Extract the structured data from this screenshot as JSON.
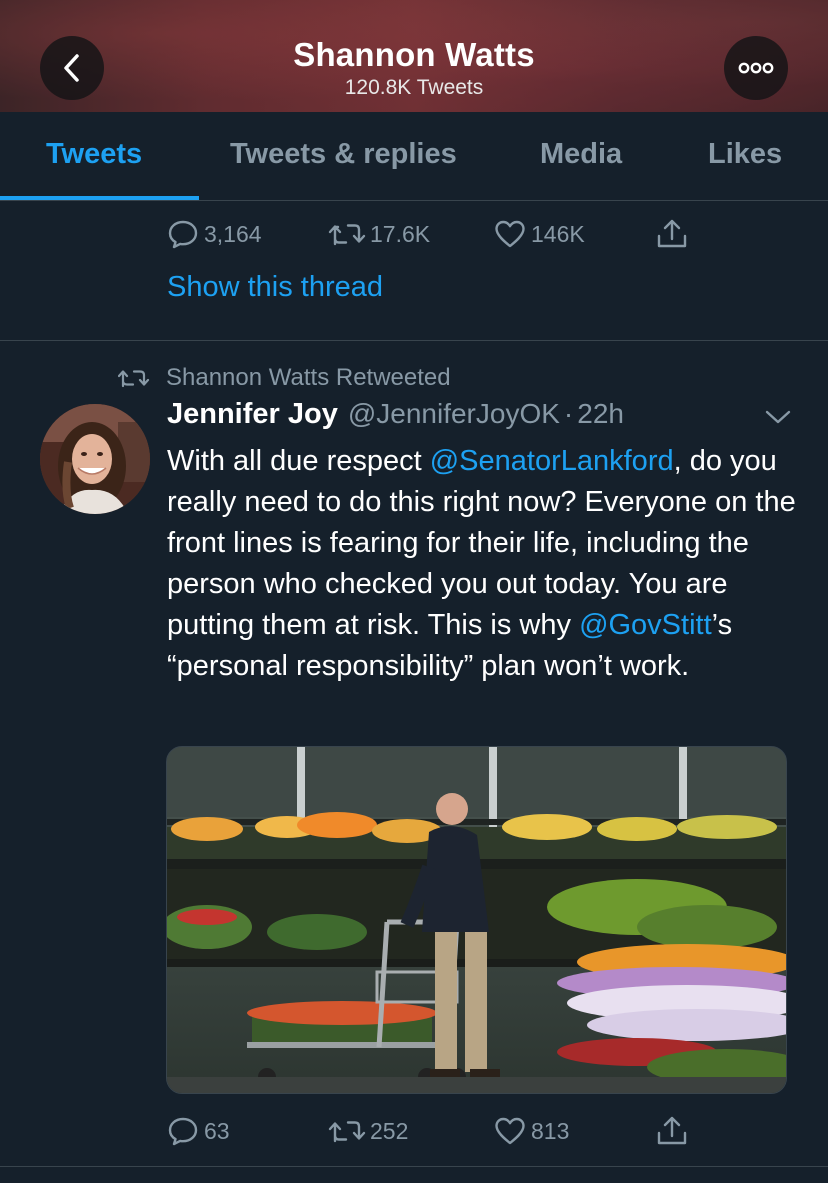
{
  "header": {
    "title": "Shannon Watts",
    "subtitle": "120.8K Tweets"
  },
  "tabs": [
    {
      "label": "Tweets",
      "active": true
    },
    {
      "label": "Tweets & replies",
      "active": false
    },
    {
      "label": "Media",
      "active": false
    },
    {
      "label": "Likes",
      "active": false
    }
  ],
  "prev_tweet": {
    "replies": "3,164",
    "retweets": "17.6K",
    "likes": "146K",
    "show_thread": "Show this thread"
  },
  "tweet": {
    "retweet_context": "Shannon Watts Retweeted",
    "author_name": "Jennifer Joy",
    "author_handle": "@JenniferJoyOK",
    "separator": "·",
    "time": "22h",
    "text_parts": {
      "p1": "With all due respect ",
      "mention1": "@SenatorLankford",
      "p2": ", do you really need to do this right now? Everyone on the front lines is fearing for their life, including the person who checked you out today. You are putting them at risk. This is why ",
      "mention2": "@GovStitt",
      "p3": "’s “personal responsibility” plan won’t work."
    },
    "replies": "63",
    "retweets": "252",
    "likes": "813"
  },
  "colors": {
    "background": "#15202b",
    "accent": "#1da1f2",
    "muted": "#8899a6",
    "border": "#38444d"
  },
  "icons": [
    "back-arrow-icon",
    "more-icon",
    "reply-icon",
    "retweet-icon",
    "like-icon",
    "share-icon",
    "chevron-down-icon"
  ]
}
